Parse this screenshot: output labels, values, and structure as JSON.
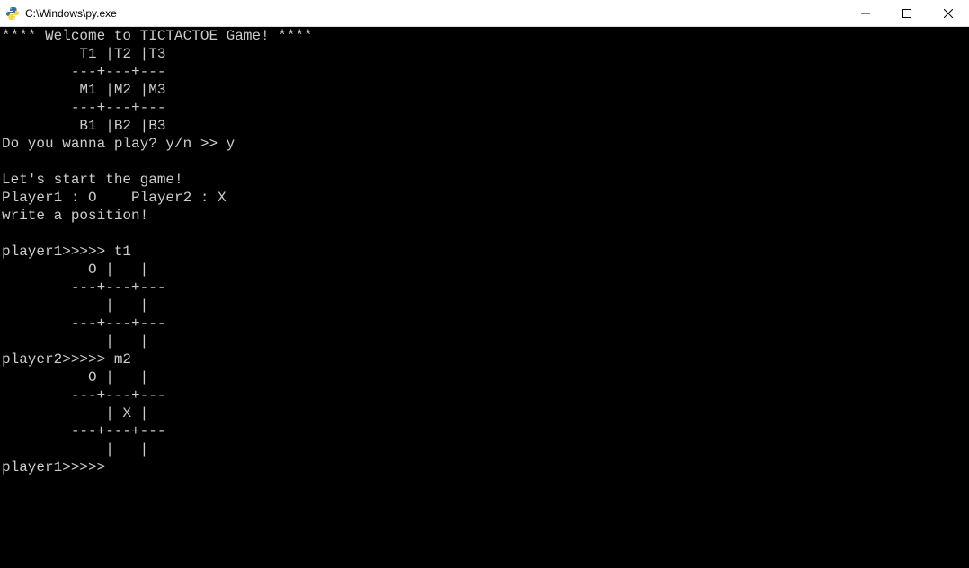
{
  "window": {
    "title": "C:\\Windows\\py.exe"
  },
  "terminal": {
    "lines": [
      "**** Welcome to TICTACTOE Game! ****",
      "         T1 |T2 |T3",
      "        ---+---+---",
      "         M1 |M2 |M3",
      "        ---+---+---",
      "         B1 |B2 |B3",
      "Do you wanna play? y/n >> y",
      "",
      "Let's start the game!",
      "Player1 : O    Player2 : X",
      "write a position!",
      "",
      "player1>>>>> t1",
      "          O |   |",
      "        ---+---+---",
      "            |   |",
      "        ---+---+---",
      "            |   |",
      "player2>>>>> m2",
      "          O |   |",
      "        ---+---+---",
      "            | X |",
      "        ---+---+---",
      "            |   |",
      "player1>>>>>"
    ]
  }
}
